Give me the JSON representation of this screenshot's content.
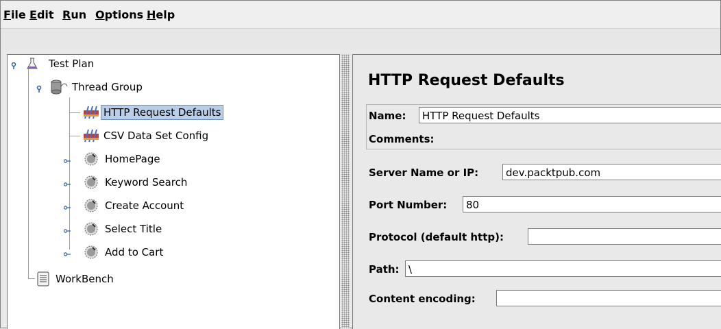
{
  "menu": {
    "file": {
      "mn": "F",
      "rest": "ile"
    },
    "edit": {
      "mn": "E",
      "rest": "dit"
    },
    "run": {
      "mn": "R",
      "rest": "un"
    },
    "options": {
      "mn": "O",
      "rest": "ptions"
    },
    "help": {
      "mn": "H",
      "rest": "elp"
    }
  },
  "tree": {
    "test_plan": "Test Plan",
    "thread_group": "Thread Group",
    "http_defaults": "HTTP Request Defaults",
    "csv_config": "CSV Data Set Config",
    "homepage": "HomePage",
    "keyword_search": "Keyword Search",
    "create_account": "Create Account",
    "select_title": "Select Title",
    "add_to_cart": "Add to Cart",
    "workbench": "WorkBench"
  },
  "form": {
    "title": "HTTP Request Defaults",
    "name_label": "Name:",
    "name_value": "HTTP Request Defaults",
    "comments_label": "Comments:",
    "server_label": "Server Name or IP:",
    "server_value": "dev.packtpub.com",
    "port_label": "Port Number:",
    "port_value": "80",
    "protocol_label": "Protocol (default http):",
    "protocol_value": "",
    "path_label": "Path:",
    "path_value": "\\",
    "encoding_label": "Content encoding:",
    "encoding_value": ""
  },
  "colors": {
    "selection": "#b9cfe9",
    "panel": "#e9e9e9"
  }
}
